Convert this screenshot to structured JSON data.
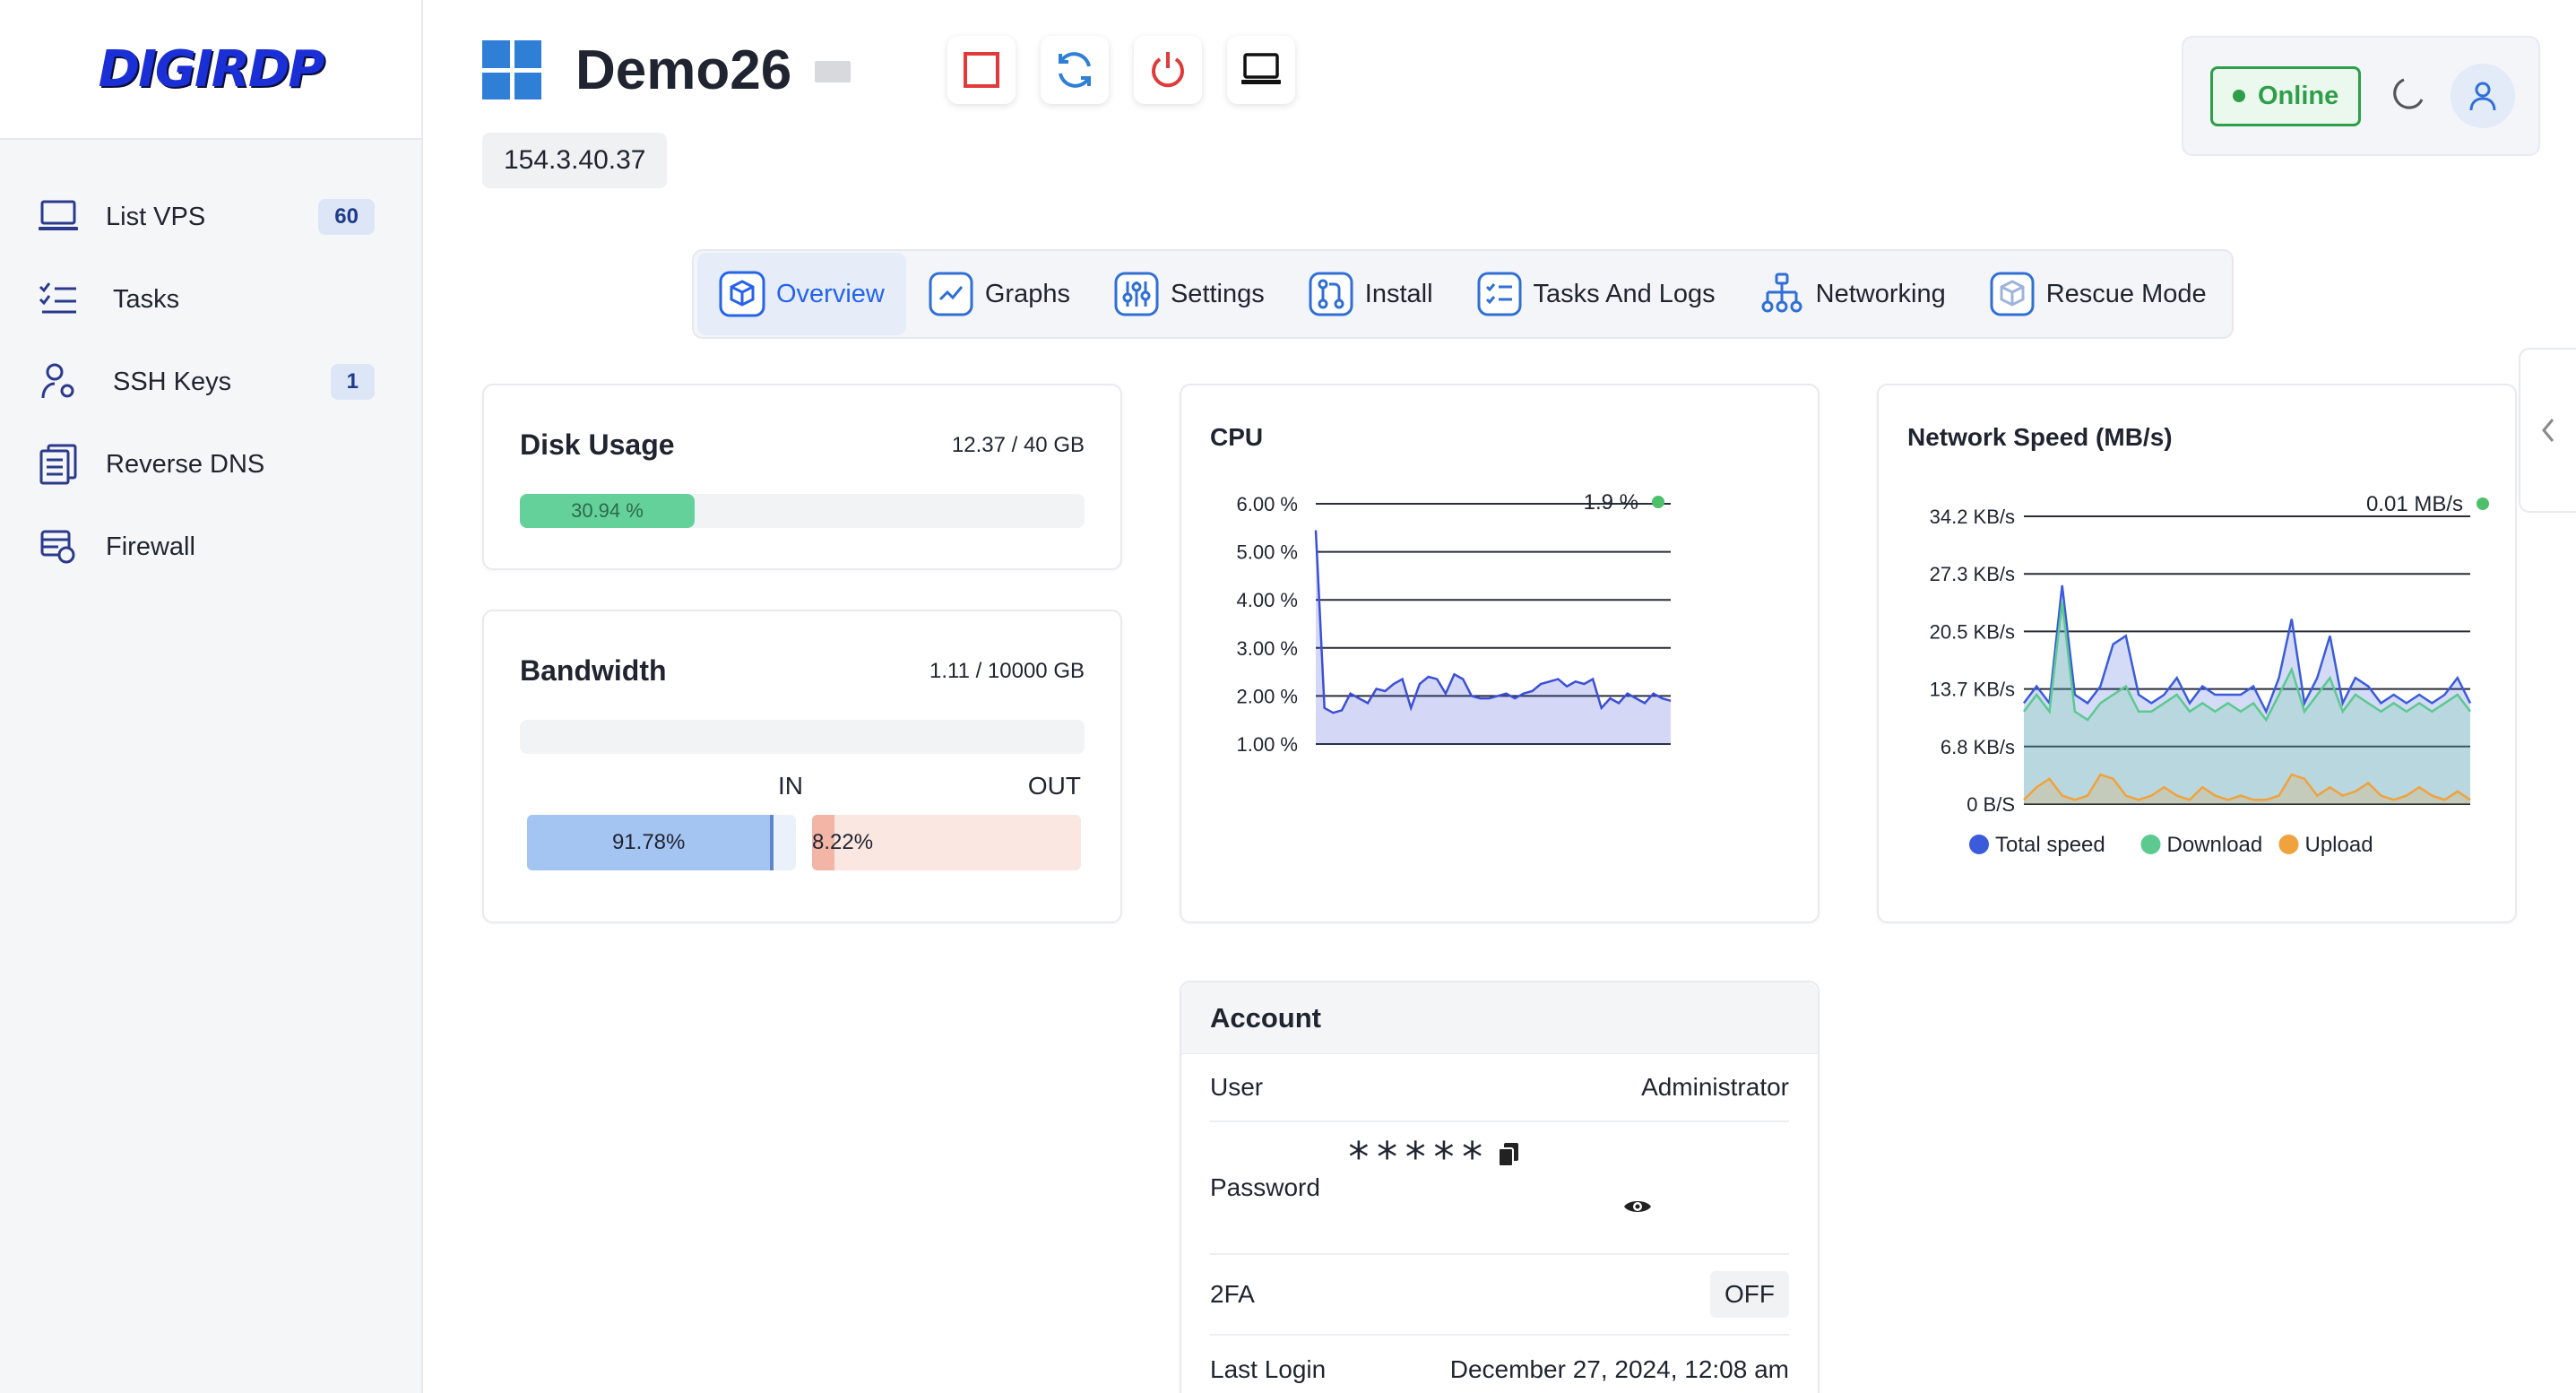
{
  "brand": {
    "logo_text": "DIGIRDP"
  },
  "sidebar": {
    "items": [
      {
        "label": "List VPS",
        "badge": "60",
        "icon": "laptop-icon"
      },
      {
        "label": "Tasks",
        "badge": "",
        "icon": "checklist-icon"
      },
      {
        "label": "SSH Keys",
        "badge": "1",
        "icon": "user-key-icon"
      },
      {
        "label": "Reverse DNS",
        "badge": "",
        "icon": "documents-icon"
      },
      {
        "label": "Firewall",
        "badge": "",
        "icon": "firewall-icon"
      }
    ]
  },
  "header": {
    "title": "Demo26",
    "ip": "154.3.40.37",
    "status": "Online"
  },
  "tabs": [
    {
      "label": "Overview",
      "icon": "cube-icon",
      "active": true
    },
    {
      "label": "Graphs",
      "icon": "line-chart-icon",
      "active": false
    },
    {
      "label": "Settings",
      "icon": "sliders-icon",
      "active": false
    },
    {
      "label": "Install",
      "icon": "git-pull-icon",
      "active": false
    },
    {
      "label": "Tasks And Logs",
      "icon": "task-list-icon",
      "active": false
    },
    {
      "label": "Networking",
      "icon": "network-tree-icon",
      "active": false
    },
    {
      "label": "Rescue Mode",
      "icon": "box-rescue-icon",
      "active": false
    }
  ],
  "disk": {
    "title": "Disk Usage",
    "usage": "12.37 / 40 GB",
    "percent_label": "30.94 %",
    "percent": 30.94
  },
  "bandwidth": {
    "title": "Bandwidth",
    "usage": "1.11 / 10000 GB",
    "in_label": "IN",
    "out_label": "OUT",
    "in_percent_label": "91.78%",
    "out_percent_label": "8.22%",
    "in_percent": 91.78,
    "out_percent": 8.22
  },
  "colors": {
    "accent": "#2563eb",
    "online": "#2e9e4a",
    "disk_fill": "#64d19a",
    "total_speed": "#3b5bdb",
    "download": "#5cc98f",
    "upload": "#f0a23c",
    "cpu_line": "#3b4fd8"
  },
  "chart_data": [
    {
      "type": "area",
      "title": "CPU",
      "current_value": "1.9 %",
      "yticks": [
        "6.00 %",
        "5.00 %",
        "4.00 %",
        "3.00 %",
        "2.00 %",
        "1.00 %"
      ],
      "ylim": [
        1,
        6
      ],
      "grid": true,
      "series": [
        {
          "values": [
            5.45,
            1.75,
            1.65,
            1.7,
            2.05,
            1.95,
            1.85,
            2.15,
            2.1,
            2.25,
            2.35,
            1.75,
            2.25,
            2.4,
            2.35,
            2.05,
            2.45,
            2.35,
            2.0,
            1.95,
            1.95,
            2.0,
            2.05,
            1.95,
            2.05,
            2.1,
            2.25,
            2.3,
            2.35,
            2.2,
            2.3,
            2.25,
            2.35,
            1.75,
            1.95,
            1.85,
            2.05,
            1.95,
            1.85,
            2.05,
            1.95,
            1.9
          ]
        }
      ]
    },
    {
      "type": "area",
      "title": "Network Speed (MB/s)",
      "current_value": "0.01 MB/s",
      "yticks": [
        "34.2 KB/s",
        "27.3 KB/s",
        "20.5 KB/s",
        "13.7 KB/s",
        "6.8 KB/s",
        "0 B/S"
      ],
      "ylim": [
        0,
        34.2
      ],
      "grid": true,
      "legend": "bottom",
      "series": [
        {
          "name": "Total speed",
          "values": [
            12,
            14,
            12,
            26,
            13,
            12,
            14,
            19,
            20,
            13,
            12,
            13,
            15,
            12,
            14,
            13,
            13,
            13,
            14,
            11,
            15,
            22,
            12,
            15,
            20,
            12,
            15,
            14,
            12,
            13,
            12,
            13,
            12,
            13,
            15,
            12
          ]
        },
        {
          "name": "Download",
          "values": [
            11,
            13,
            11,
            24,
            11,
            10,
            12,
            13,
            14,
            11,
            11,
            12,
            13,
            11,
            12,
            11,
            12,
            11,
            12,
            10,
            13,
            16,
            11,
            13,
            15,
            11,
            13,
            12,
            11,
            12,
            11,
            12,
            11,
            12,
            13,
            11
          ]
        },
        {
          "name": "Upload",
          "values": [
            0.5,
            2,
            3,
            1,
            0.5,
            1,
            3.5,
            3,
            1,
            0.5,
            1,
            2,
            1,
            0.5,
            2,
            1,
            0.5,
            1,
            0.5,
            0.5,
            1,
            3.5,
            3,
            1,
            2,
            1,
            1.5,
            2.5,
            1,
            0.5,
            1,
            2,
            1,
            0.5,
            1.5,
            0.5
          ]
        }
      ]
    }
  ],
  "account": {
    "title": "Account",
    "user_label": "User",
    "user_value": "Administrator",
    "password_label": "Password",
    "password_value": "*****",
    "twofa_label": "2FA",
    "twofa_value": "OFF",
    "last_login_label": "Last Login",
    "last_login_value": "December 27, 2024, 12:08 am"
  }
}
